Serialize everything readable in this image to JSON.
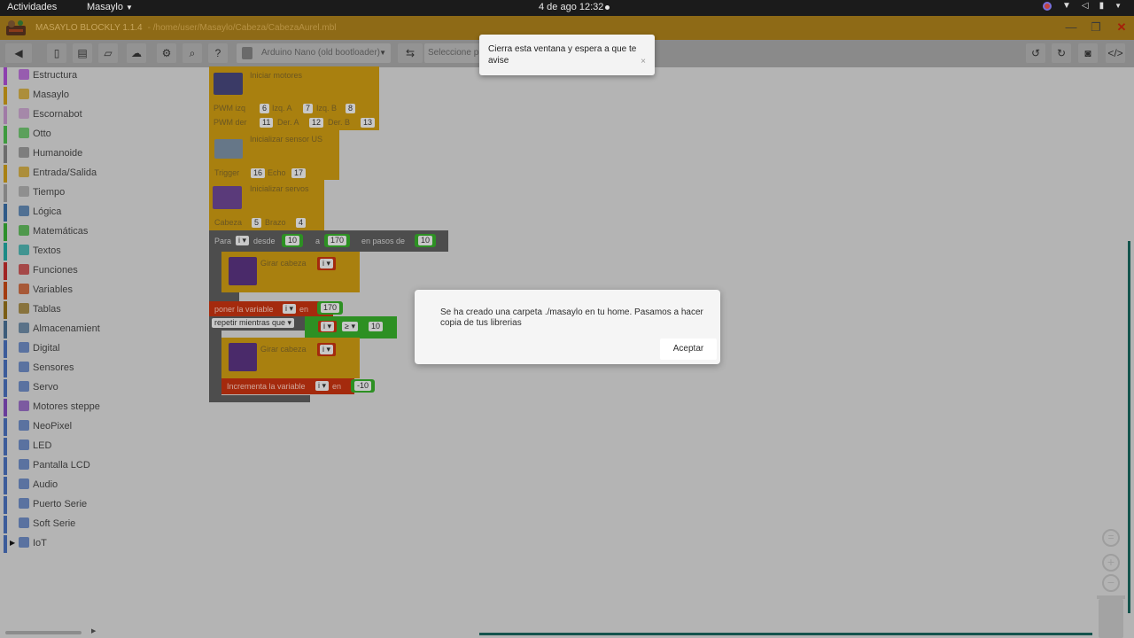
{
  "topbar": {
    "activities": "Actividades",
    "app_name": "Masaylo",
    "clock": "4 de ago  12:32"
  },
  "window": {
    "title": "MASAYLO BLOCKLY 1.1.4",
    "path": "- /home/user/Masaylo/Cabeza/CabezaAurel.mbl"
  },
  "toolbar": {
    "board": "Arduino Nano (old bootloader)",
    "port": "Seleccione p"
  },
  "sidebar": {
    "items": [
      {
        "label": "Estructura",
        "color": "#8d3fae"
      },
      {
        "label": "Masaylo",
        "color": "#a98113"
      },
      {
        "label": "Escornabot",
        "color": "#a07aa6"
      },
      {
        "label": "Otto",
        "color": "#3d9a3d"
      },
      {
        "label": "Humanoide",
        "color": "#6c6c6c"
      },
      {
        "label": "Entrada/Salida",
        "color": "#a98113"
      },
      {
        "label": "Tiempo",
        "color": "#838383"
      },
      {
        "label": "Lógica",
        "color": "#2f5a88"
      },
      {
        "label": "Matemáticas",
        "color": "#2d8f2a"
      },
      {
        "label": "Textos",
        "color": "#1b8a86"
      },
      {
        "label": "Funciones",
        "color": "#a02424"
      },
      {
        "label": "Variables",
        "color": "#a33b0f"
      },
      {
        "label": "Tablas",
        "color": "#7a5d15"
      },
      {
        "label": "Almacenamiento",
        "color": "#3c5c7a"
      },
      {
        "label": "Digital",
        "color": "#3c5c9a"
      },
      {
        "label": "Sensores",
        "color": "#3c5c9a"
      },
      {
        "label": "Servo",
        "color": "#3c5c9a"
      },
      {
        "label": "Motores steppers",
        "color": "#6a3c9a"
      },
      {
        "label": "NeoPixel",
        "color": "#3c5c9a"
      },
      {
        "label": "LED",
        "color": "#3c5c9a"
      },
      {
        "label": "Pantalla LCD",
        "color": "#3c5c9a"
      },
      {
        "label": "Audio",
        "color": "#3c5c9a"
      },
      {
        "label": "Puerto Serie",
        "color": "#3c5c9a"
      },
      {
        "label": "Soft Serie",
        "color": "#3c5c9a"
      },
      {
        "label": "IoT",
        "color": "#3c5c9a"
      }
    ]
  },
  "blocks": {
    "motor": {
      "title": "Iniciar motores",
      "pwm_izq_label": "PWM izq",
      "pwm_izq": "6",
      "izq_a_label": "Izq. A",
      "izq_a": "7",
      "izq_b_label": "Izq. B",
      "izq_b": "8",
      "pwm_der_label": "PWM der",
      "pwm_der": "11",
      "der_a_label": "Der. A",
      "der_a": "12",
      "der_b_label": "Der. B",
      "der_b": "13"
    },
    "sensor": {
      "title": "Inicializar sensor US",
      "trigger_label": "Trigger",
      "trigger": "16",
      "echo_label": "Echo",
      "echo": "17"
    },
    "servo": {
      "title": "Inicializar servos",
      "cabeza_label": "Cabeza",
      "cabeza": "5",
      "brazo_label": "Brazo",
      "brazo": "4"
    },
    "for_loop": {
      "prefix": "Para",
      "var": "i ▾",
      "desde": "desde",
      "from": "10",
      "a": "a",
      "to": "170",
      "step_label": "en pasos de",
      "step": "10"
    },
    "girar1": {
      "label": "Girar cabeza",
      "var": "i ▾"
    },
    "set_var": {
      "label": "poner la variable",
      "var": "i ▾",
      "en": "en",
      "value": "170"
    },
    "while_loop": {
      "label": "repetir mientras que ▾",
      "var": "i ▾",
      "op": "≥ ▾",
      "value": "10"
    },
    "girar2": {
      "label": "Girar cabeza",
      "var": "i ▾"
    },
    "increment": {
      "label": "Incrementa la variable",
      "var": "i ▾",
      "en": "en",
      "value": "-10"
    }
  },
  "toast": {
    "message": "Cierra esta ventana y espera a que te avise",
    "close": "×"
  },
  "dialog": {
    "message": "Se ha creado una carpeta ./masaylo en tu home. Pasamos a hacer copia de tus librerias",
    "button": "Aceptar"
  }
}
